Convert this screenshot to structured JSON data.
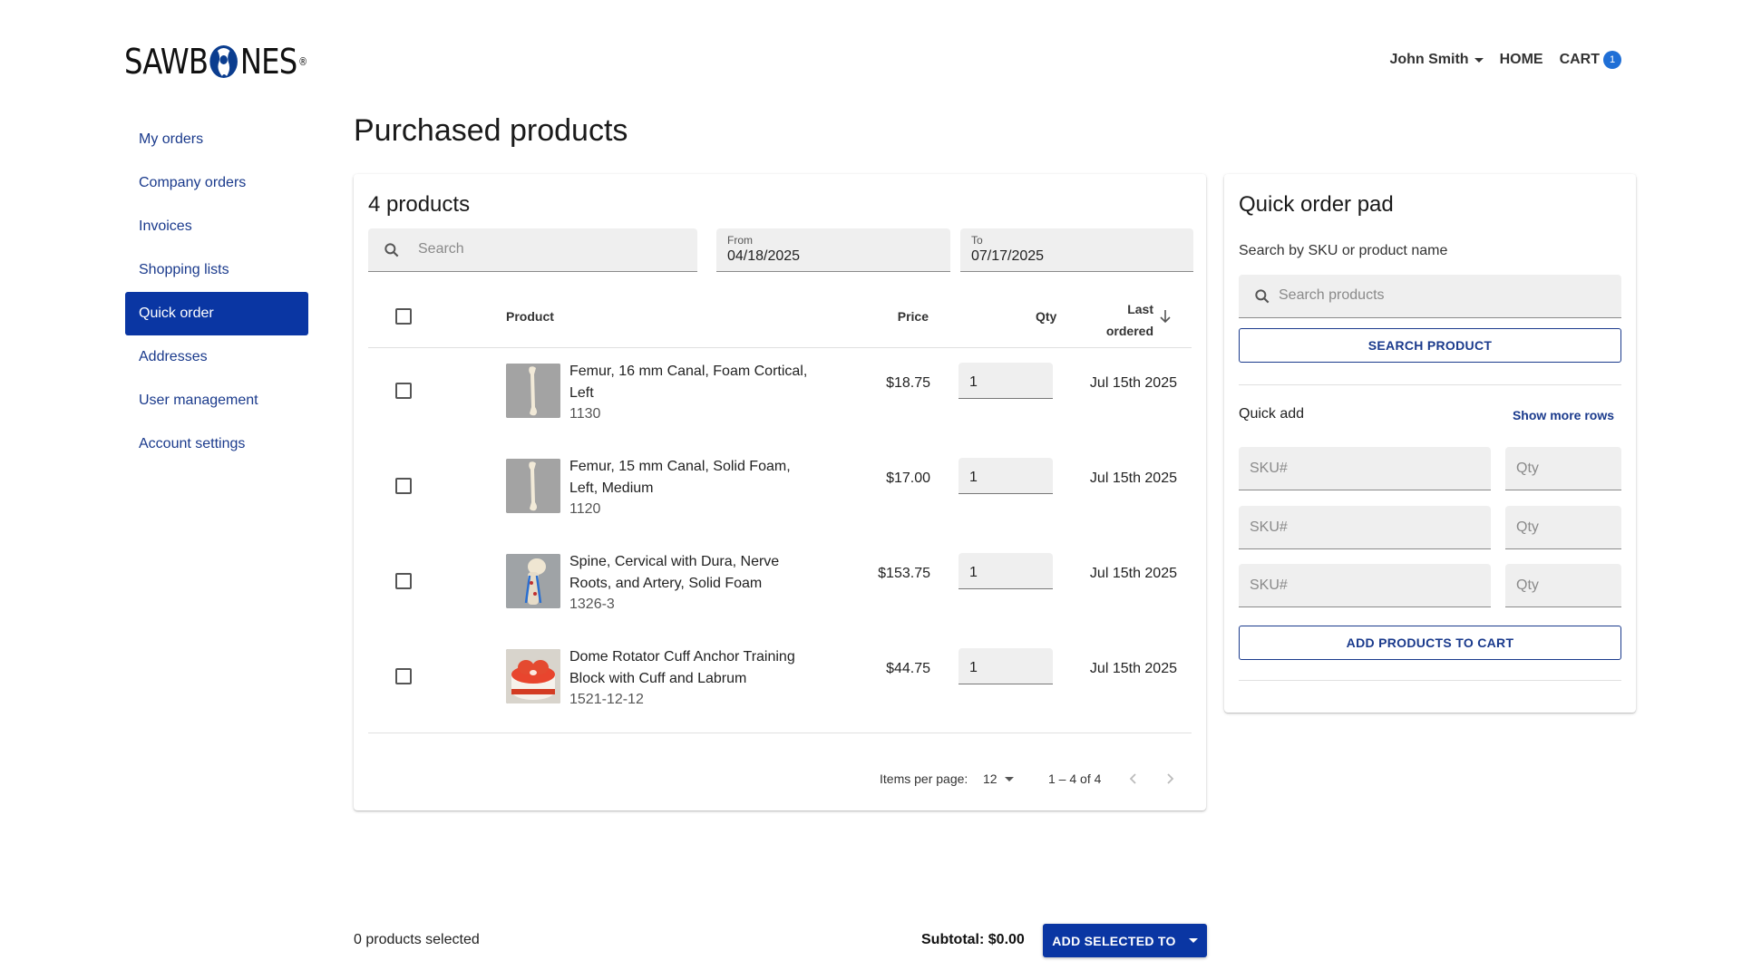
{
  "header": {
    "logo_text_left": "SAWB",
    "logo_text_right": "NES",
    "logo_reg": "®",
    "user_name": "John Smith",
    "home_label": "HOME",
    "cart_label": "CART",
    "cart_count": "1"
  },
  "sidebar": {
    "items": [
      {
        "label": "My orders"
      },
      {
        "label": "Company orders"
      },
      {
        "label": "Invoices"
      },
      {
        "label": "Shopping lists"
      },
      {
        "label": "Quick order"
      },
      {
        "label": "Addresses"
      },
      {
        "label": "User management"
      },
      {
        "label": "Account settings"
      }
    ],
    "active_index": 4
  },
  "page": {
    "title": "Purchased products"
  },
  "products": {
    "count_label": "4 products",
    "search_placeholder": "Search",
    "from_label": "From",
    "from_value": "04/18/2025",
    "to_label": "To",
    "to_value": "07/17/2025",
    "columns": {
      "product": "Product",
      "price": "Price",
      "qty": "Qty",
      "last_ordered_1": "Last",
      "last_ordered_2": "ordered"
    },
    "rows": [
      {
        "name": "Femur, 16 mm Canal, Foam Cortical, Left",
        "sku": "1130",
        "price": "$18.75",
        "qty": "1",
        "last_ordered": "Jul 15th 2025",
        "thumb": "femur-thumbnail"
      },
      {
        "name": "Femur, 15 mm Canal, Solid Foam, Left, Medium",
        "sku": "1120",
        "price": "$17.00",
        "qty": "1",
        "last_ordered": "Jul 15th 2025",
        "thumb": "femur-thumbnail"
      },
      {
        "name": "Spine, Cervical with Dura, Nerve Roots, and Artery, Solid Foam",
        "sku": "1326-3",
        "price": "$153.75",
        "qty": "1",
        "last_ordered": "Jul 15th 2025",
        "thumb": "spine-thumbnail"
      },
      {
        "name": "Dome Rotator Cuff Anchor Training Block with Cuff and Labrum",
        "sku": "1521-12-12",
        "price": "$44.75",
        "qty": "1",
        "last_ordered": "Jul 15th 2025",
        "thumb": "rotator-cuff-thumbnail"
      }
    ],
    "pager": {
      "items_per_page_label": "Items per page:",
      "items_per_page_value": "12",
      "range_label": "1 – 4 of 4"
    }
  },
  "quick_order": {
    "title": "Quick order pad",
    "search_label": "Search by SKU or product name",
    "search_placeholder": "Search products",
    "search_button": "SEARCH PRODUCT",
    "quick_add_label": "Quick add",
    "show_more_rows": "Show more rows",
    "sku_placeholder": "SKU#",
    "qty_placeholder": "Qty",
    "add_button": "ADD PRODUCTS TO CART"
  },
  "footer": {
    "selected_label": "0 products selected",
    "subtotal_label": "Subtotal: $0.00",
    "add_selected_button": "ADD SELECTED TO"
  },
  "colors": {
    "primary": "#0a36a3",
    "link": "#1a3a8c",
    "badge": "#1f6fd6"
  }
}
